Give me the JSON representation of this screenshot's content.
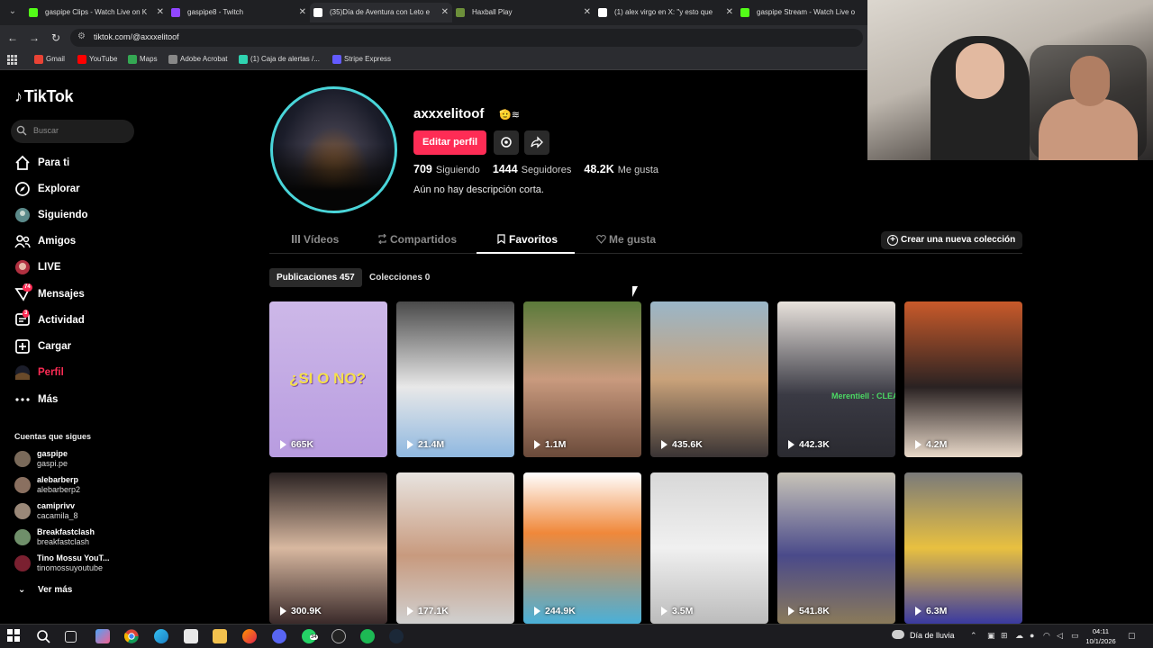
{
  "browser": {
    "tabs": [
      {
        "title": "gaspipe Clips - Watch Live on K",
        "color": "#53fc18",
        "active": false
      },
      {
        "title": "gaspipe8 - Twitch",
        "color": "#9146ff",
        "active": false
      },
      {
        "title": "(35)Día de Aventura con Leto e",
        "color": "#ffffff",
        "active": true
      },
      {
        "title": "Haxball Play",
        "color": "#6c8f3a",
        "active": false
      },
      {
        "title": "(1) alex virgo en X: \"y esto que",
        "color": "#ffffff",
        "active": false
      },
      {
        "title": "gaspipe Stream - Watch Live o",
        "color": "#53fc18",
        "active": false
      }
    ],
    "url": "tiktok.com/@axxxelitoof",
    "bookmarks": [
      {
        "label": "Gmail",
        "color": "#ea4335"
      },
      {
        "label": "YouTube",
        "color": "#ff0000"
      },
      {
        "label": "Maps",
        "color": "#34a853"
      },
      {
        "label": "Adobe Acrobat",
        "color": "#888888"
      },
      {
        "label": "(1) Caja de alertas /...",
        "color": "#2fd3b0"
      },
      {
        "label": "Stripe Express",
        "color": "#635bff"
      }
    ]
  },
  "sidebar": {
    "logo": "TikTok",
    "search_placeholder": "Buscar",
    "nav": [
      {
        "label": "Para ti",
        "icon": "home-icon"
      },
      {
        "label": "Explorar",
        "icon": "compass-icon"
      },
      {
        "label": "Siguiendo",
        "icon": "following-avatar-icon"
      },
      {
        "label": "Amigos",
        "icon": "friends-icon"
      },
      {
        "label": "LIVE",
        "icon": "live-avatar-icon"
      },
      {
        "label": "Mensajes",
        "icon": "messages-icon",
        "badge": "74"
      },
      {
        "label": "Actividad",
        "icon": "activity-icon",
        "badge": "3"
      },
      {
        "label": "Cargar",
        "icon": "upload-icon"
      },
      {
        "label": "Perfil",
        "icon": "profile-avatar-icon",
        "active": true
      },
      {
        "label": "Más",
        "icon": "more-icon"
      }
    ],
    "following_title": "Cuentas que sigues",
    "following": [
      {
        "name": "gaspipe",
        "handle": "gaspi.pe",
        "color": "#7a6a5a"
      },
      {
        "name": "alebarberp",
        "handle": "alebarberp2",
        "color": "#8a7060"
      },
      {
        "name": "camiprivv",
        "handle": "cacamila_8",
        "color": "#9a8878"
      },
      {
        "name": "Breakfastclash",
        "handle": "breakfastclash",
        "color": "#6f8f6a"
      },
      {
        "name": "Tino Mossu YouT...",
        "handle": "tinomossuyoutube",
        "color": "#7a2030"
      }
    ],
    "see_more": "Ver más"
  },
  "profile": {
    "username": "axxxelitoof",
    "emoji": "🫡≋",
    "edit_button": "Editar perfil",
    "following_count": "709",
    "following_label": "Siguiendo",
    "followers_count": "1444",
    "followers_label": "Seguidores",
    "likes_count": "48.2K",
    "likes_label": "Me gusta",
    "bio": "Aún no hay descripción corta."
  },
  "tabs": {
    "videos": "Vídeos",
    "reposts": "Compartidos",
    "favorites": "Favoritos",
    "liked": "Me gusta",
    "new_collection": "Crear una nueva colección",
    "posts": "Publicaciones 457",
    "collections": "Colecciones 0"
  },
  "videos": [
    {
      "views": "665K",
      "bg": "linear-gradient(180deg,#cdb8e8 0%,#b89ce0 100%)",
      "overlay": "¿SI O NO?",
      "overlay_color": "#f4e04a"
    },
    {
      "views": "21.4M",
      "bg": "linear-gradient(180deg,#4a4a4a 0%,#e8e8e8 55%,#8fb8e0 100%)",
      "overlay": "",
      "overlay_color": ""
    },
    {
      "views": "1.1M",
      "bg": "linear-gradient(180deg,#5b7a3a 0%,#c99a7e 50%,#6a4a3a 100%)",
      "overlay": "",
      "overlay_color": ""
    },
    {
      "views": "435.6K",
      "bg": "linear-gradient(180deg,#9ab6c8 0%,#c9a27a 50%,#3a3434 100%)",
      "overlay": "",
      "overlay_color": ""
    },
    {
      "views": "442.3K",
      "bg": "linear-gradient(180deg,#e8e2dc 0%,#3a3a44 60%,#2a2a30 100%)",
      "overlay": "Merentiell : CLEAN",
      "overlay_color": "#4cd964"
    },
    {
      "views": "4.2M",
      "bg": "linear-gradient(180deg,#c95a2a 0%,#2a2222 55%,#e8d8c8 100%)",
      "overlay": "",
      "overlay_color": ""
    },
    {
      "views": "300.9K",
      "bg": "linear-gradient(180deg,#2a2222 0%,#d8b8a0 50%,#3a2a2a 100%)",
      "overlay": "",
      "overlay_color": ""
    },
    {
      "views": "177.1K",
      "bg": "linear-gradient(180deg,#e8e4e0 0%,#c89a7e 55%,#d0d0d0 100%)",
      "overlay": "",
      "overlay_color": ""
    },
    {
      "views": "244.9K",
      "bg": "linear-gradient(180deg,#ffffff 0%,#f0883a 40%,#4ab0d8 100%)",
      "overlay": "",
      "overlay_color": ""
    },
    {
      "views": "3.5M",
      "bg": "linear-gradient(180deg,#d8d8d8 0%,#f0f0f0 50%,#bcbcbc 100%)",
      "overlay": "",
      "overlay_color": ""
    },
    {
      "views": "541.8K",
      "bg": "linear-gradient(180deg,#c8c4b8 0%,#4a4a8a 55%,#8a7a5a 100%)",
      "overlay": "",
      "overlay_color": ""
    },
    {
      "views": "6.3M",
      "bg": "linear-gradient(180deg,#7a7a7a 0%,#e8c040 50%,#3a3aa0 100%)",
      "overlay": "",
      "overlay_color": ""
    }
  ],
  "taskbar": {
    "weather": "Día de lluvia",
    "time": "04:11",
    "date": "10/1/2026",
    "whatsapp_badge": "34"
  },
  "colors": {
    "accent": "#fe2c55",
    "avatar_ring": "#49d5d9"
  }
}
